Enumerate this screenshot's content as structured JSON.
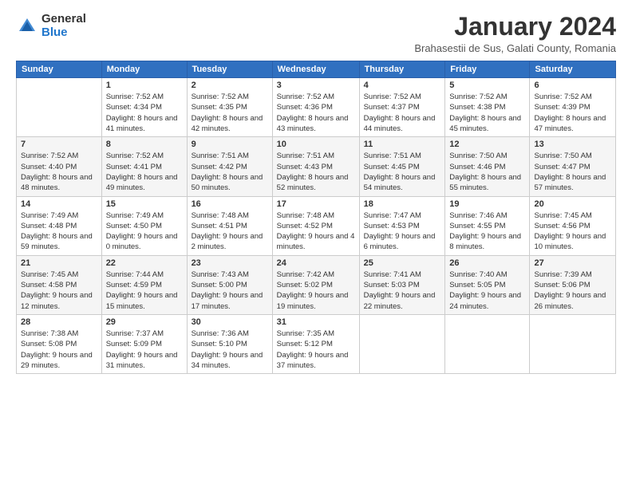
{
  "logo": {
    "general": "General",
    "blue": "Blue"
  },
  "title": "January 2024",
  "subtitle": "Brahasestii de Sus, Galati County, Romania",
  "headers": [
    "Sunday",
    "Monday",
    "Tuesday",
    "Wednesday",
    "Thursday",
    "Friday",
    "Saturday"
  ],
  "weeks": [
    [
      {
        "day": "",
        "sunrise": "",
        "sunset": "",
        "daylight": ""
      },
      {
        "day": "1",
        "sunrise": "Sunrise: 7:52 AM",
        "sunset": "Sunset: 4:34 PM",
        "daylight": "Daylight: 8 hours and 41 minutes."
      },
      {
        "day": "2",
        "sunrise": "Sunrise: 7:52 AM",
        "sunset": "Sunset: 4:35 PM",
        "daylight": "Daylight: 8 hours and 42 minutes."
      },
      {
        "day": "3",
        "sunrise": "Sunrise: 7:52 AM",
        "sunset": "Sunset: 4:36 PM",
        "daylight": "Daylight: 8 hours and 43 minutes."
      },
      {
        "day": "4",
        "sunrise": "Sunrise: 7:52 AM",
        "sunset": "Sunset: 4:37 PM",
        "daylight": "Daylight: 8 hours and 44 minutes."
      },
      {
        "day": "5",
        "sunrise": "Sunrise: 7:52 AM",
        "sunset": "Sunset: 4:38 PM",
        "daylight": "Daylight: 8 hours and 45 minutes."
      },
      {
        "day": "6",
        "sunrise": "Sunrise: 7:52 AM",
        "sunset": "Sunset: 4:39 PM",
        "daylight": "Daylight: 8 hours and 47 minutes."
      }
    ],
    [
      {
        "day": "7",
        "sunrise": "Sunrise: 7:52 AM",
        "sunset": "Sunset: 4:40 PM",
        "daylight": "Daylight: 8 hours and 48 minutes."
      },
      {
        "day": "8",
        "sunrise": "Sunrise: 7:52 AM",
        "sunset": "Sunset: 4:41 PM",
        "daylight": "Daylight: 8 hours and 49 minutes."
      },
      {
        "day": "9",
        "sunrise": "Sunrise: 7:51 AM",
        "sunset": "Sunset: 4:42 PM",
        "daylight": "Daylight: 8 hours and 50 minutes."
      },
      {
        "day": "10",
        "sunrise": "Sunrise: 7:51 AM",
        "sunset": "Sunset: 4:43 PM",
        "daylight": "Daylight: 8 hours and 52 minutes."
      },
      {
        "day": "11",
        "sunrise": "Sunrise: 7:51 AM",
        "sunset": "Sunset: 4:45 PM",
        "daylight": "Daylight: 8 hours and 54 minutes."
      },
      {
        "day": "12",
        "sunrise": "Sunrise: 7:50 AM",
        "sunset": "Sunset: 4:46 PM",
        "daylight": "Daylight: 8 hours and 55 minutes."
      },
      {
        "day": "13",
        "sunrise": "Sunrise: 7:50 AM",
        "sunset": "Sunset: 4:47 PM",
        "daylight": "Daylight: 8 hours and 57 minutes."
      }
    ],
    [
      {
        "day": "14",
        "sunrise": "Sunrise: 7:49 AM",
        "sunset": "Sunset: 4:48 PM",
        "daylight": "Daylight: 8 hours and 59 minutes."
      },
      {
        "day": "15",
        "sunrise": "Sunrise: 7:49 AM",
        "sunset": "Sunset: 4:50 PM",
        "daylight": "Daylight: 9 hours and 0 minutes."
      },
      {
        "day": "16",
        "sunrise": "Sunrise: 7:48 AM",
        "sunset": "Sunset: 4:51 PM",
        "daylight": "Daylight: 9 hours and 2 minutes."
      },
      {
        "day": "17",
        "sunrise": "Sunrise: 7:48 AM",
        "sunset": "Sunset: 4:52 PM",
        "daylight": "Daylight: 9 hours and 4 minutes."
      },
      {
        "day": "18",
        "sunrise": "Sunrise: 7:47 AM",
        "sunset": "Sunset: 4:53 PM",
        "daylight": "Daylight: 9 hours and 6 minutes."
      },
      {
        "day": "19",
        "sunrise": "Sunrise: 7:46 AM",
        "sunset": "Sunset: 4:55 PM",
        "daylight": "Daylight: 9 hours and 8 minutes."
      },
      {
        "day": "20",
        "sunrise": "Sunrise: 7:45 AM",
        "sunset": "Sunset: 4:56 PM",
        "daylight": "Daylight: 9 hours and 10 minutes."
      }
    ],
    [
      {
        "day": "21",
        "sunrise": "Sunrise: 7:45 AM",
        "sunset": "Sunset: 4:58 PM",
        "daylight": "Daylight: 9 hours and 12 minutes."
      },
      {
        "day": "22",
        "sunrise": "Sunrise: 7:44 AM",
        "sunset": "Sunset: 4:59 PM",
        "daylight": "Daylight: 9 hours and 15 minutes."
      },
      {
        "day": "23",
        "sunrise": "Sunrise: 7:43 AM",
        "sunset": "Sunset: 5:00 PM",
        "daylight": "Daylight: 9 hours and 17 minutes."
      },
      {
        "day": "24",
        "sunrise": "Sunrise: 7:42 AM",
        "sunset": "Sunset: 5:02 PM",
        "daylight": "Daylight: 9 hours and 19 minutes."
      },
      {
        "day": "25",
        "sunrise": "Sunrise: 7:41 AM",
        "sunset": "Sunset: 5:03 PM",
        "daylight": "Daylight: 9 hours and 22 minutes."
      },
      {
        "day": "26",
        "sunrise": "Sunrise: 7:40 AM",
        "sunset": "Sunset: 5:05 PM",
        "daylight": "Daylight: 9 hours and 24 minutes."
      },
      {
        "day": "27",
        "sunrise": "Sunrise: 7:39 AM",
        "sunset": "Sunset: 5:06 PM",
        "daylight": "Daylight: 9 hours and 26 minutes."
      }
    ],
    [
      {
        "day": "28",
        "sunrise": "Sunrise: 7:38 AM",
        "sunset": "Sunset: 5:08 PM",
        "daylight": "Daylight: 9 hours and 29 minutes."
      },
      {
        "day": "29",
        "sunrise": "Sunrise: 7:37 AM",
        "sunset": "Sunset: 5:09 PM",
        "daylight": "Daylight: 9 hours and 31 minutes."
      },
      {
        "day": "30",
        "sunrise": "Sunrise: 7:36 AM",
        "sunset": "Sunset: 5:10 PM",
        "daylight": "Daylight: 9 hours and 34 minutes."
      },
      {
        "day": "31",
        "sunrise": "Sunrise: 7:35 AM",
        "sunset": "Sunset: 5:12 PM",
        "daylight": "Daylight: 9 hours and 37 minutes."
      },
      {
        "day": "",
        "sunrise": "",
        "sunset": "",
        "daylight": ""
      },
      {
        "day": "",
        "sunrise": "",
        "sunset": "",
        "daylight": ""
      },
      {
        "day": "",
        "sunrise": "",
        "sunset": "",
        "daylight": ""
      }
    ]
  ]
}
